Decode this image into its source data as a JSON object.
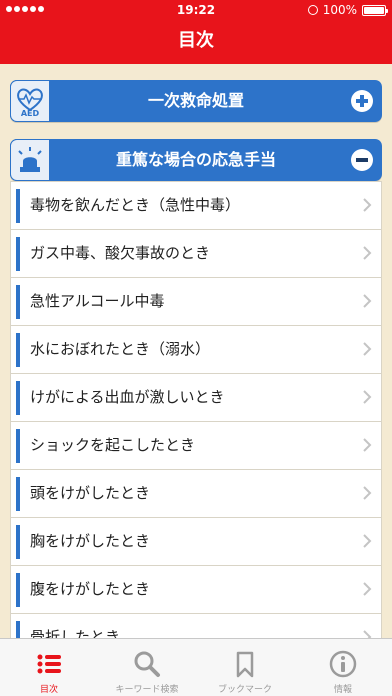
{
  "status_bar": {
    "time": "19:22",
    "battery": "100%"
  },
  "nav": {
    "title": "目次"
  },
  "sections": [
    {
      "title": "一次救命処置",
      "icon_name": "aed-icon",
      "icon_text": "AED",
      "expanded": false
    },
    {
      "title": "重篤な場合の応急手当",
      "icon_name": "siren-icon",
      "expanded": true
    }
  ],
  "items": [
    {
      "label": "毒物を飲んだとき（急性中毒）"
    },
    {
      "label": "ガス中毒、酸欠事故のとき"
    },
    {
      "label": "急性アルコール中毒"
    },
    {
      "label": "水におぼれたとき（溺水）"
    },
    {
      "label": "けがによる出血が激しいとき"
    },
    {
      "label": "ショックを起こしたとき"
    },
    {
      "label": "頭をけがしたとき"
    },
    {
      "label": "胸をけがしたとき"
    },
    {
      "label": "腹をけがしたとき"
    },
    {
      "label": "骨折したとき"
    }
  ],
  "tabs": [
    {
      "label": "目次",
      "icon": "list-icon",
      "active": true
    },
    {
      "label": "キーワード検索",
      "icon": "search-icon",
      "active": false
    },
    {
      "label": "ブックマーク",
      "icon": "bookmark-icon",
      "active": false
    },
    {
      "label": "情報",
      "icon": "info-icon",
      "active": false
    }
  ],
  "colors": {
    "brand_red": "#e8141b",
    "section_blue": "#2d73c9",
    "background": "#f4ead2"
  }
}
